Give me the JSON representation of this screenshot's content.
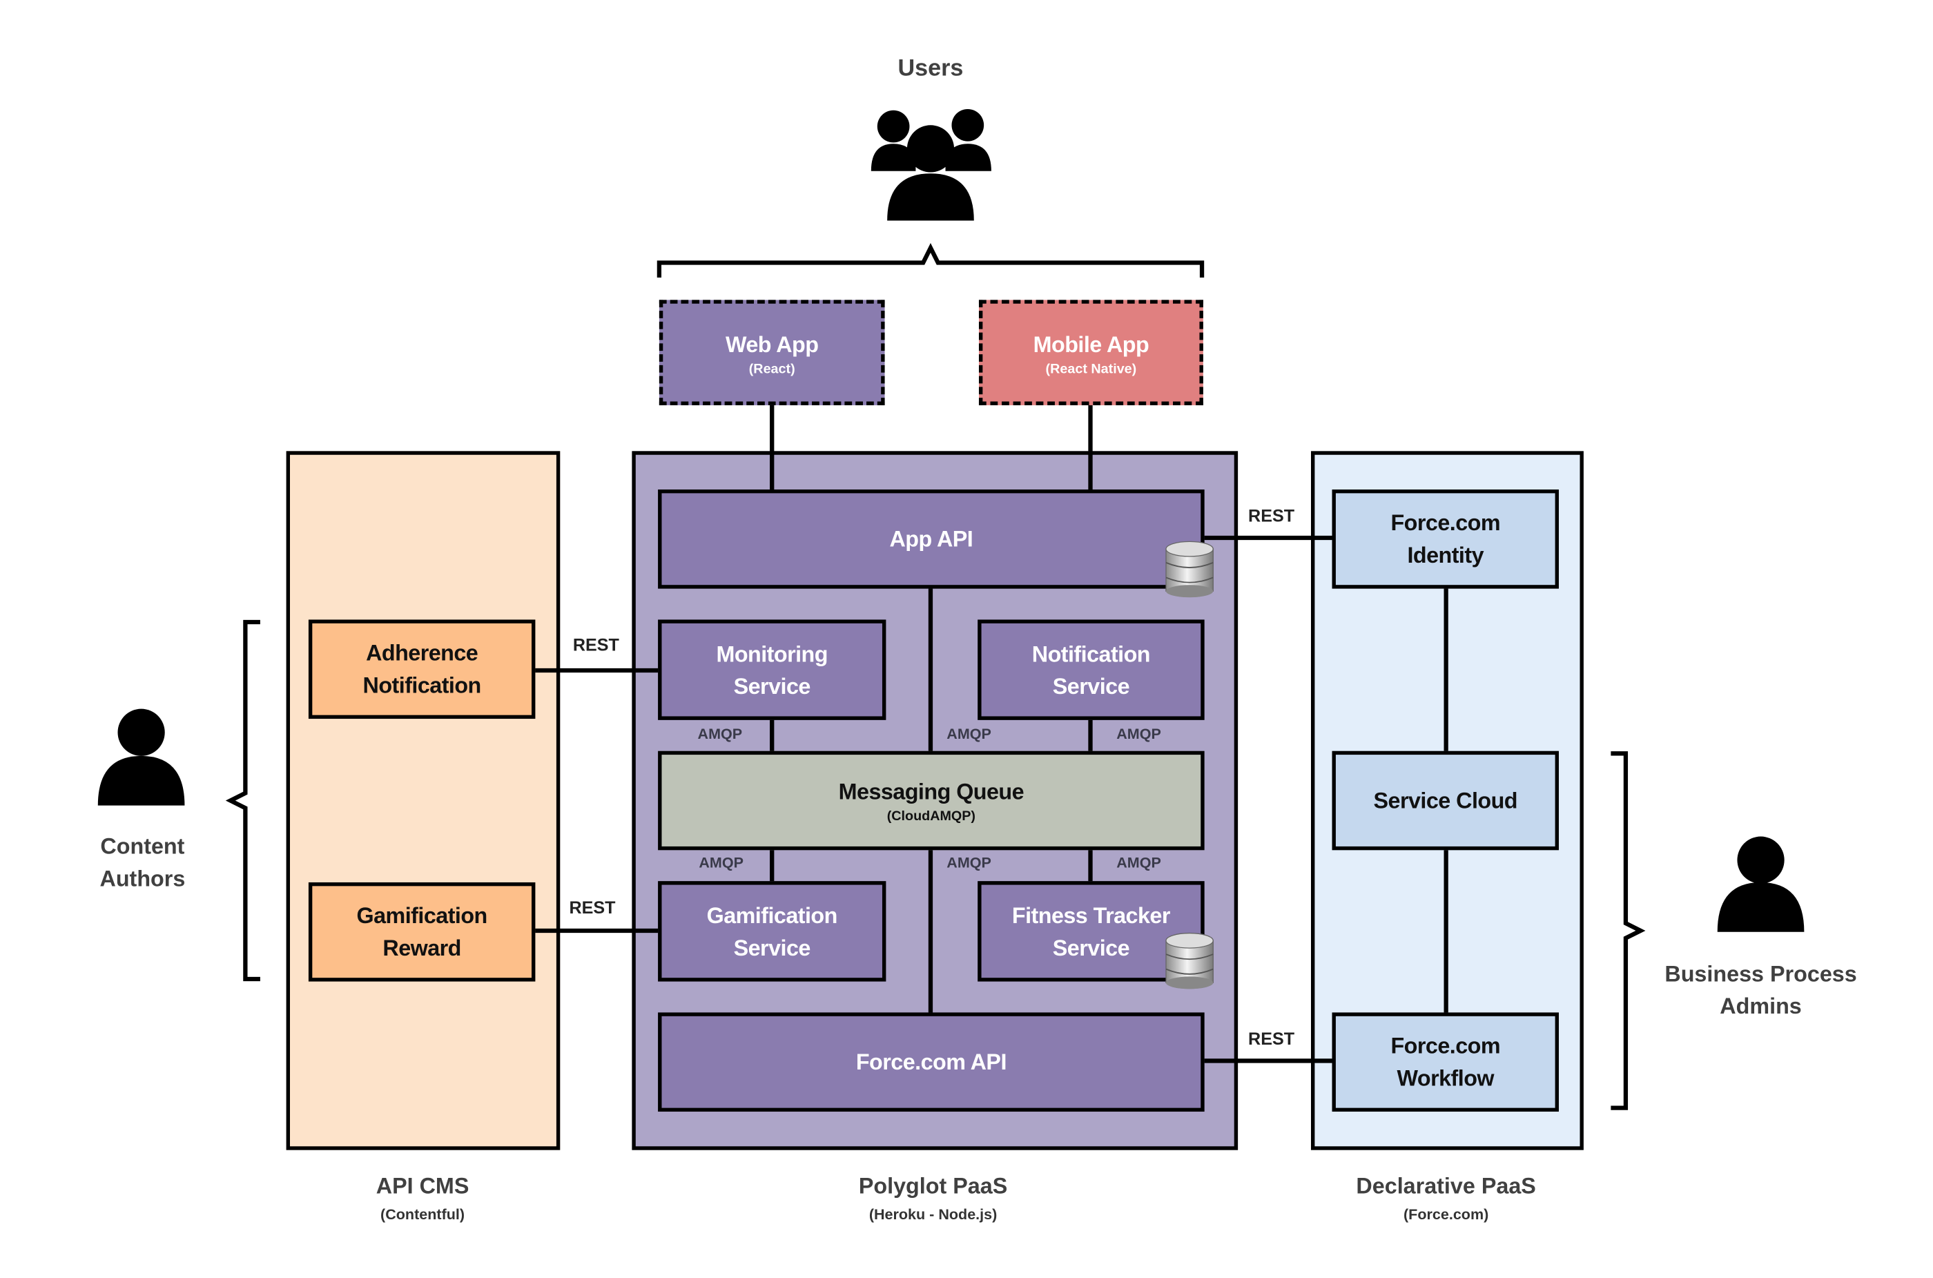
{
  "users": {
    "label": "Users"
  },
  "clients": {
    "web_app": {
      "title": "Web App",
      "subtitle": "(React)",
      "color": "#8a7caf"
    },
    "mobile_app": {
      "title": "Mobile App",
      "subtitle": "(React Native)",
      "color": "#e08080"
    }
  },
  "regions": {
    "api_cms": {
      "title": "API CMS",
      "subtitle": "(Contentful)",
      "color": "#fde3ca"
    },
    "polyglot": {
      "title": "Polyglot PaaS",
      "subtitle": "(Heroku - Node.js)",
      "color": "#ada5c8"
    },
    "declarative": {
      "title": "Declarative PaaS",
      "subtitle": "(Force.com)",
      "color": "#e3eefa"
    }
  },
  "cms": {
    "adherence": "Adherence Notification",
    "gamification_reward": "Gamification Reward",
    "color": "#fdbf8a"
  },
  "paas": {
    "app_api": "App API",
    "monitoring": "Monitoring Service",
    "notification": "Notification Service",
    "queue_title": "Messaging Queue",
    "queue_subtitle": "(CloudAMQP)",
    "gamification_service": "Gamification Service",
    "fitness": "Fitness Tracker Service",
    "force_api": "Force.com API",
    "service_color": "#8a7caf",
    "queue_color": "#bec3b7"
  },
  "force": {
    "identity": "Force.com Identity",
    "service_cloud": "Service Cloud",
    "workflow": "Force.com Workflow",
    "color": "#c5d8ee"
  },
  "protocols": {
    "rest": "REST",
    "amqp": "AMQP"
  },
  "actors": {
    "content_authors": "Content Authors",
    "bp_admins": "Business Process Admins"
  }
}
